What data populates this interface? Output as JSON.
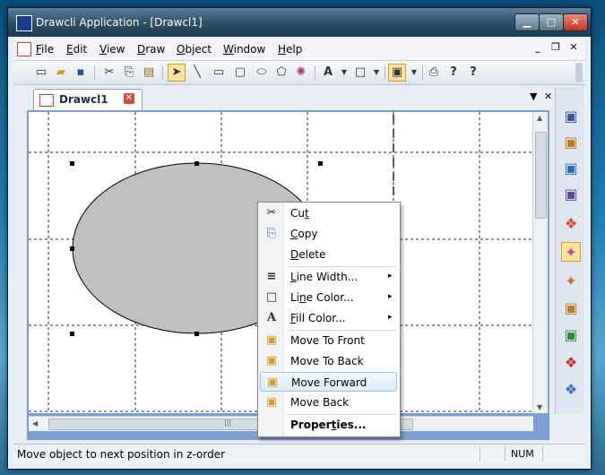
{
  "window": {
    "title": "Drawcli Application - [Drawcl1]",
    "caption_buttons": {
      "minimize": "▁",
      "maximize": "□",
      "close": "✕"
    }
  },
  "menubar": {
    "items": [
      "File",
      "Edit",
      "View",
      "Draw",
      "Object",
      "Window",
      "Help"
    ],
    "mdi_controls": {
      "minimize": "_",
      "restore": "❐",
      "close": "✕"
    }
  },
  "toolbar": {
    "icons": [
      "new-icon",
      "open-icon",
      "save-icon",
      "cut-icon",
      "copy-icon",
      "paste-icon",
      "select-arrow-icon",
      "line-icon",
      "rectangle-icon",
      "rounded-rectangle-icon",
      "ellipse-icon",
      "polygon-icon",
      "shape-outline-icon",
      "font-icon",
      "color-icon",
      "line-color-icon",
      "frame-icon",
      "print-icon",
      "help-icon",
      "context-help-icon"
    ],
    "glyphs": {
      "font": "A",
      "help": "?",
      "context_help": "?"
    }
  },
  "tabstrip": {
    "tab_title": "Drawcl1",
    "controls": {
      "dropdown": "▼",
      "close": "✕"
    }
  },
  "scroll": {
    "thumb_grip": "|||"
  },
  "context_menu": {
    "items": [
      {
        "label_pre": "Cu",
        "label_u": "t",
        "label_post": "",
        "icon": "scissors-icon",
        "glyph": "✂"
      },
      {
        "label_pre": "",
        "label_u": "C",
        "label_post": "opy",
        "icon": "copy-icon",
        "glyph": "⎘"
      },
      {
        "label_pre": "",
        "label_u": "D",
        "label_post": "elete",
        "icon": "",
        "glyph": ""
      },
      {
        "label_pre": "",
        "label_u": "L",
        "label_post": "ine Width...",
        "icon": "line-width-icon",
        "glyph": "≡",
        "submenu": true
      },
      {
        "label_pre": "Li",
        "label_u": "n",
        "label_post": "e Color...",
        "icon": "line-color-icon",
        "glyph": "□",
        "submenu": true
      },
      {
        "label_pre": "",
        "label_u": "F",
        "label_post": "ill Color...",
        "icon": "fill-color-icon",
        "glyph": "A",
        "submenu": true
      },
      {
        "label_pre": "Move To Front",
        "label_u": "",
        "label_post": "",
        "icon": "move-to-front-icon",
        "glyph": "▣"
      },
      {
        "label_pre": "Move To Back",
        "label_u": "",
        "label_post": "",
        "icon": "move-to-back-icon",
        "glyph": "▣"
      },
      {
        "label_pre": "Move Forward",
        "label_u": "",
        "label_post": "",
        "icon": "move-forward-icon",
        "glyph": "▣",
        "highlighted": true
      },
      {
        "label_pre": "Move Back",
        "label_u": "",
        "label_post": "",
        "icon": "move-back-icon",
        "glyph": "▣"
      },
      {
        "label_pre": "Proper",
        "label_u": "t",
        "label_post": "ies...",
        "icon": "",
        "glyph": "",
        "bold": true
      }
    ],
    "submenu_arrow": "▸"
  },
  "right_toolbar": {
    "icons": [
      "style-office-2000-icon",
      "style-office-xp-icon",
      "style-office-2003-icon",
      "style-vs2005-icon",
      "style-windows-xp-icon",
      "style-office-2007-icon",
      "style-office-2007-alt-icon",
      "style-vs2008-icon",
      "style-blue-icon",
      "style-black-icon",
      "style-silver-icon"
    ]
  },
  "statusbar": {
    "text": "Move object to next position in z-order",
    "num": "NUM"
  },
  "colors": {
    "ellipse_fill": "#c0c0c0",
    "grid_line": "#1b1b6b",
    "highlight_border": "#9ec5e8"
  }
}
